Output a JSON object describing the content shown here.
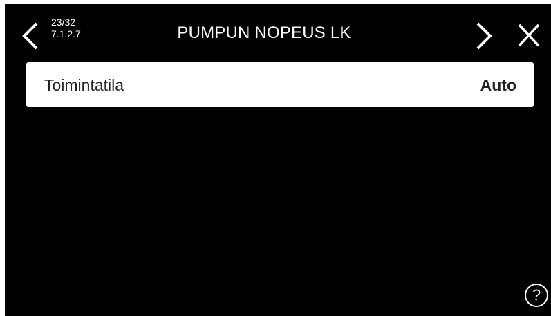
{
  "header": {
    "page_counter": "23/32",
    "menu_path": "7.1.2.7",
    "title": "PUMPUN NOPEUS LK",
    "back_icon": "chevron-left-icon",
    "next_icon": "chevron-right-icon",
    "close_icon": "close-icon"
  },
  "settings": [
    {
      "label": "Toimintatila",
      "value": "Auto"
    }
  ],
  "help": {
    "label": "?",
    "icon": "help-icon"
  },
  "colors": {
    "background": "#000000",
    "row_background": "#ffffff",
    "foreground": "#ffffff"
  }
}
